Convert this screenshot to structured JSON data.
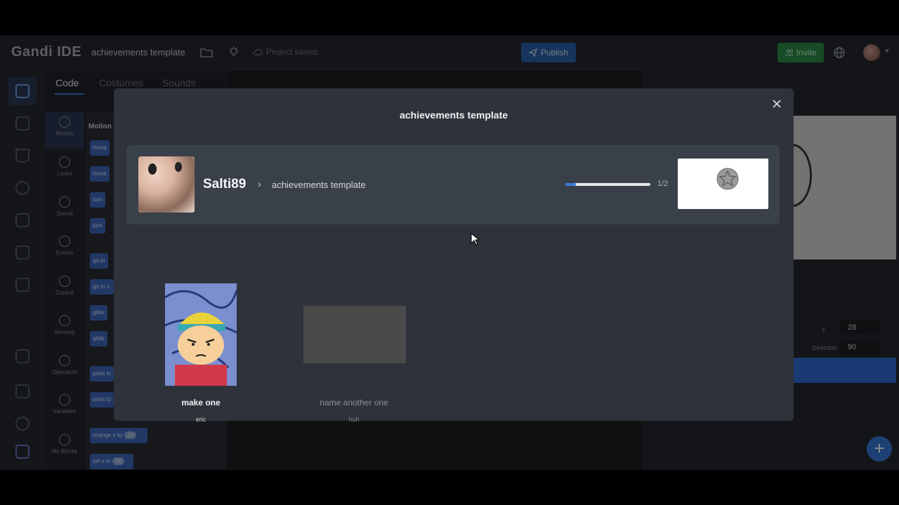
{
  "app": {
    "logo": "Gandi IDE",
    "project_title": "achievements template",
    "save_status": "Project saved.",
    "publish_label": "Publish",
    "invite_label": "Invite"
  },
  "editor_tabs": [
    "Code",
    "Costumes",
    "Sounds"
  ],
  "categories": [
    "Motion",
    "Looks",
    "Sound",
    "Events",
    "Control",
    "Sensing",
    "Operators",
    "Variables",
    "My Blocks"
  ],
  "palette": {
    "heading": "Motion",
    "blocks": [
      "move",
      "move",
      "turn",
      "turn",
      "go to",
      "go to x:",
      "glide",
      "glide",
      "point in",
      "point to",
      "change x by",
      "set x to"
    ],
    "change_x_value": "10",
    "set_x_value": "36"
  },
  "sprite_info": {
    "y_label": "y",
    "y_value": "28",
    "direction_label": "Direction",
    "direction_value": "90"
  },
  "modal": {
    "title": "achievements template",
    "username": "Salti89",
    "breadcrumb": "achievements template",
    "progress_text": "1/2",
    "progress_fraction": 0.12,
    "achievements": [
      {
        "name": "make one",
        "description": "eric",
        "unlocked": true
      },
      {
        "name": "name another one",
        "description": "huh",
        "unlocked": false
      }
    ]
  },
  "colors": {
    "accent": "#3b7ad8",
    "publish": "#2b5fa8",
    "invite": "#2a8a45"
  }
}
